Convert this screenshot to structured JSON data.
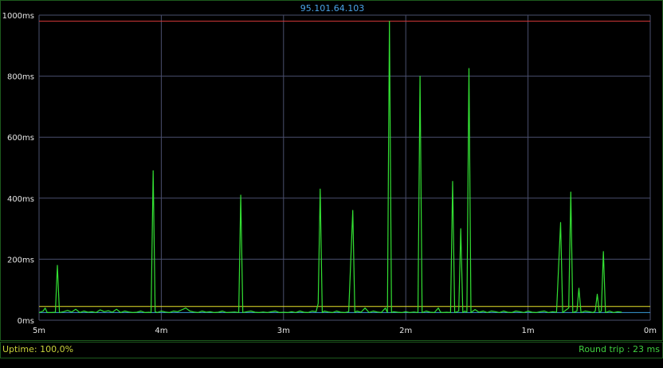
{
  "title": "95.101.64.103",
  "status": {
    "uptime": "Uptime: 100,0%",
    "round_trip": "Round trip : 23 ms"
  },
  "colors": {
    "grid": "#4a4f6e",
    "latency_line": "#33e033",
    "max_line": "#d83a3a",
    "avg_line": "#3a9bd8",
    "baseline_line": "#e8e22a",
    "title": "#4aa3e8"
  },
  "chart_data": {
    "type": "line",
    "title": "95.101.64.103",
    "xlabel": "",
    "ylabel": "",
    "xlim": [
      300,
      0
    ],
    "ylim": [
      0,
      1000
    ],
    "x_ticks": [
      {
        "value": 300,
        "label": "5m"
      },
      {
        "value": 240,
        "label": "4m"
      },
      {
        "value": 180,
        "label": "3m"
      },
      {
        "value": 120,
        "label": "2m"
      },
      {
        "value": 60,
        "label": "1m"
      },
      {
        "value": 0,
        "label": "0m"
      }
    ],
    "y_ticks": [
      {
        "value": 0,
        "label": "0ms"
      },
      {
        "value": 200,
        "label": "200ms"
      },
      {
        "value": 400,
        "label": "400ms"
      },
      {
        "value": 600,
        "label": "600ms"
      },
      {
        "value": 800,
        "label": "800ms"
      },
      {
        "value": 1000,
        "label": "1000ms"
      }
    ],
    "grid": true,
    "reference_lines": [
      {
        "value": 980,
        "color": "#d83a3a"
      },
      {
        "value": 45,
        "color": "#e8e22a"
      },
      {
        "value": 25,
        "color": "#3a9bd8"
      }
    ],
    "series": [
      {
        "color": "#33e033",
        "points": [
          [
            300,
            25
          ],
          [
            298,
            30
          ],
          [
            297,
            40
          ],
          [
            296,
            25
          ],
          [
            294,
            25
          ],
          [
            292,
            26
          ],
          [
            291,
            180
          ],
          [
            290,
            25
          ],
          [
            288,
            28
          ],
          [
            286,
            32
          ],
          [
            284,
            27
          ],
          [
            282,
            36
          ],
          [
            280,
            25
          ],
          [
            278,
            30
          ],
          [
            276,
            26
          ],
          [
            274,
            28
          ],
          [
            272,
            25
          ],
          [
            270,
            34
          ],
          [
            268,
            28
          ],
          [
            266,
            31
          ],
          [
            264,
            26
          ],
          [
            262,
            36
          ],
          [
            260,
            25
          ],
          [
            258,
            30
          ],
          [
            256,
            27
          ],
          [
            254,
            25
          ],
          [
            252,
            26
          ],
          [
            250,
            30
          ],
          [
            248,
            25
          ],
          [
            246,
            26
          ],
          [
            245,
            25
          ],
          [
            244,
            490
          ],
          [
            243,
            28
          ],
          [
            242,
            25
          ],
          [
            240,
            30
          ],
          [
            238,
            27
          ],
          [
            236,
            25
          ],
          [
            234,
            30
          ],
          [
            232,
            28
          ],
          [
            230,
            34
          ],
          [
            228,
            40
          ],
          [
            226,
            30
          ],
          [
            224,
            27
          ],
          [
            222,
            25
          ],
          [
            220,
            30
          ],
          [
            218,
            26
          ],
          [
            216,
            28
          ],
          [
            214,
            25
          ],
          [
            212,
            26
          ],
          [
            210,
            30
          ],
          [
            208,
            25
          ],
          [
            204,
            27
          ],
          [
            202,
            25
          ],
          [
            201,
            410
          ],
          [
            200,
            25
          ],
          [
            198,
            28
          ],
          [
            196,
            30
          ],
          [
            194,
            26
          ],
          [
            192,
            25
          ],
          [
            190,
            27
          ],
          [
            188,
            25
          ],
          [
            186,
            28
          ],
          [
            184,
            30
          ],
          [
            182,
            25
          ],
          [
            180,
            26
          ],
          [
            178,
            25
          ],
          [
            176,
            28
          ],
          [
            174,
            25
          ],
          [
            172,
            30
          ],
          [
            170,
            26
          ],
          [
            168,
            25
          ],
          [
            166,
            30
          ],
          [
            164,
            28
          ],
          [
            163,
            55
          ],
          [
            162,
            430
          ],
          [
            161,
            25
          ],
          [
            160,
            30
          ],
          [
            158,
            27
          ],
          [
            156,
            25
          ],
          [
            154,
            30
          ],
          [
            152,
            26
          ],
          [
            150,
            25
          ],
          [
            148,
            28
          ],
          [
            146,
            360
          ],
          [
            145,
            25
          ],
          [
            144,
            30
          ],
          [
            142,
            26
          ],
          [
            140,
            40
          ],
          [
            138,
            25
          ],
          [
            136,
            30
          ],
          [
            134,
            27
          ],
          [
            132,
            25
          ],
          [
            130,
            40
          ],
          [
            129,
            25
          ],
          [
            128,
            980
          ],
          [
            127,
            25
          ],
          [
            126,
            28
          ],
          [
            124,
            26
          ],
          [
            122,
            25
          ],
          [
            120,
            28
          ],
          [
            118,
            25
          ],
          [
            116,
            27
          ],
          [
            114,
            25
          ],
          [
            113,
            800
          ],
          [
            112,
            25
          ],
          [
            110,
            30
          ],
          [
            108,
            26
          ],
          [
            106,
            25
          ],
          [
            104,
            40
          ],
          [
            103,
            27
          ],
          [
            102,
            25
          ],
          [
            100,
            26
          ],
          [
            98,
            25
          ],
          [
            97,
            455
          ],
          [
            96,
            25
          ],
          [
            94,
            30
          ],
          [
            93,
            300
          ],
          [
            92,
            25
          ],
          [
            91,
            30
          ],
          [
            90,
            26
          ],
          [
            89,
            825
          ],
          [
            88,
            25
          ],
          [
            86,
            35
          ],
          [
            84,
            26
          ],
          [
            82,
            30
          ],
          [
            80,
            25
          ],
          [
            78,
            30
          ],
          [
            76,
            28
          ],
          [
            74,
            25
          ],
          [
            72,
            30
          ],
          [
            70,
            26
          ],
          [
            68,
            25
          ],
          [
            66,
            30
          ],
          [
            64,
            28
          ],
          [
            62,
            25
          ],
          [
            60,
            30
          ],
          [
            58,
            26
          ],
          [
            56,
            25
          ],
          [
            54,
            28
          ],
          [
            52,
            30
          ],
          [
            50,
            25
          ],
          [
            48,
            28
          ],
          [
            46,
            26
          ],
          [
            44,
            320
          ],
          [
            43,
            25
          ],
          [
            42,
            30
          ],
          [
            40,
            40
          ],
          [
            39,
            420
          ],
          [
            38,
            25
          ],
          [
            36,
            30
          ],
          [
            35,
            105
          ],
          [
            34,
            25
          ],
          [
            32,
            30
          ],
          [
            30,
            28
          ],
          [
            28,
            25
          ],
          [
            27,
            30
          ],
          [
            26,
            85
          ],
          [
            25,
            25
          ],
          [
            24,
            30
          ],
          [
            23,
            225
          ],
          [
            22,
            25
          ],
          [
            20,
            30
          ],
          [
            18,
            25
          ],
          [
            16,
            28
          ],
          [
            14,
            26
          ]
        ]
      }
    ]
  }
}
